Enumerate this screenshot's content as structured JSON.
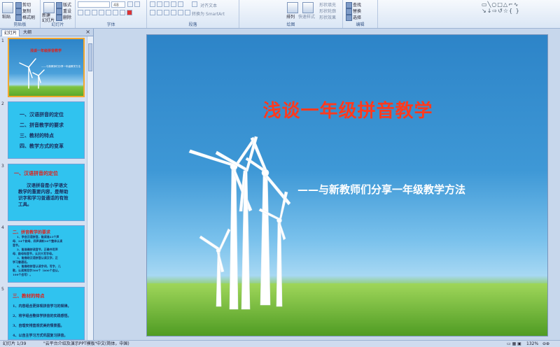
{
  "ribbon": {
    "clipboard": {
      "label": "剪贴板",
      "paste": "粘贴",
      "cut": "剪切",
      "copy": "复制",
      "format_painter": "格式刷"
    },
    "slides": {
      "label": "幻灯片",
      "new_slide": "新建\n幻灯片",
      "layout": "版式",
      "reset": "重设",
      "delete": "删除"
    },
    "font": {
      "label": "字体",
      "size": "48"
    },
    "paragraph": {
      "label": "段落",
      "align_text": "对齐文本",
      "convert_smartart": "转换为 SmartArt"
    },
    "drawing": {
      "label": "绘图",
      "arrange": "排列",
      "quick_styles": "快速样式",
      "shape_fill": "形状填充",
      "shape_outline": "形状轮廓",
      "shape_effects": "形状效果"
    },
    "editing": {
      "label": "编辑",
      "find": "查找",
      "replace": "替换",
      "select": "选择"
    }
  },
  "panel": {
    "tab_slides": "幻灯片",
    "tab_outline": "大纲",
    "close": "×",
    "thumbs": [
      {
        "num": "1",
        "title": "浅谈一年级拼音教学",
        "subtitle": "——与新教师们分享一年级教学方法"
      },
      {
        "num": "2",
        "lines": [
          "一、汉语拼音的定位",
          "二、拼音教学的要求",
          "三、教材的特点",
          "四、教学方式的变革"
        ]
      },
      {
        "num": "3",
        "heading": "一、汉语拼音的定位",
        "body": [
          "汉语拼音是小学语文",
          "教学的重要内容，是帮助",
          "识字和学习普通话的有效",
          "工具。"
        ]
      },
      {
        "num": "4",
        "heading": "二、拼音教学的要求",
        "body": [
          "1、学会汉语拼音，能读准23个声",
          "母、24个韵母、四声调和16个整体认读",
          "音节。",
          "2、能准确拼读音节，正确书写声",
          "母、韵母和音节，认识大写字母。",
          "3、能借助汉语拼音认读汉字，正",
          "学习普通话。",
          "4、能借助拼音认读字词，写字，儿",
          "歌，认读常用字500个（600个会认，",
          "100个会写）。"
        ]
      },
      {
        "num": "5",
        "heading": "三、教材的特点",
        "body": [
          "1、内容组合更体现拼音学习的规律。",
          "2、将字组合整体学拼音的实践感悟。",
          "3、自理安排直观优美的情景图。",
          "4、以自主学习方式巩固复习拼音。"
        ]
      }
    ]
  },
  "slide": {
    "title": "浅谈一年级拼音教学",
    "subtitle": "——与新教师们分享一年级教学方法"
  },
  "status": {
    "slide_count": "幻灯片 1/39",
    "theme": "\"云平台介绍及演示PPT模板\"",
    "language": "中文(简体，中国)",
    "zoom": "132%"
  },
  "colors": {
    "title_red": "#ff3a1e",
    "thumb_blue": "#30c3ef",
    "thumb_text_red": "#e0201a",
    "thumb_text_dark": "#1a2a5a"
  }
}
